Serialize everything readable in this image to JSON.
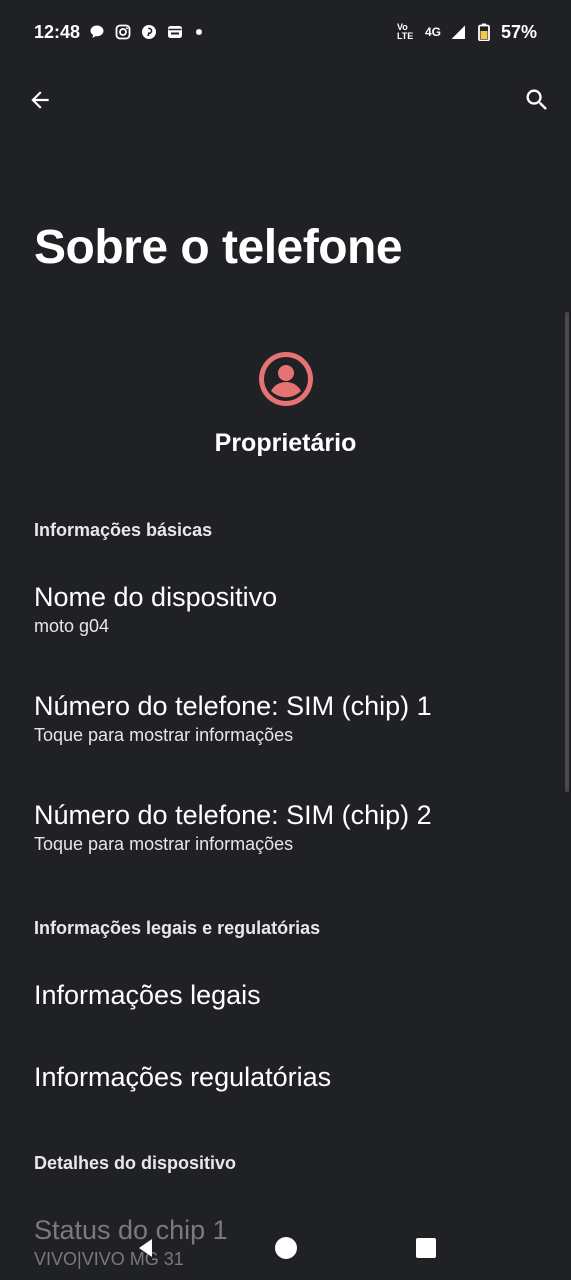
{
  "status_bar": {
    "time": "12:48",
    "net_volte": "Vo LTE",
    "net_type": "4G",
    "battery": "57%",
    "icons": [
      "chat-bubble-icon",
      "instagram-icon",
      "pinterest-icon",
      "mail-icon",
      "dot-icon",
      "signal-icon",
      "battery-icon"
    ]
  },
  "appbar": {
    "back_icon": "arrow-left-icon",
    "search_icon": "search-icon"
  },
  "page": {
    "title": "Sobre o telefone"
  },
  "owner": {
    "name": "Proprietário",
    "avatar_color": "#e57373"
  },
  "sections": {
    "basic": {
      "header": "Informações básicas",
      "items": [
        {
          "title": "Nome do dispositivo",
          "summary": "moto g04"
        },
        {
          "title": "Número do telefone: SIM (chip) 1",
          "summary": "Toque para mostrar informações"
        },
        {
          "title": "Número do telefone: SIM (chip) 2",
          "summary": "Toque para mostrar informações"
        }
      ]
    },
    "legal": {
      "header": "Informações legais e regulatórias",
      "items": [
        {
          "title": "Informações legais"
        },
        {
          "title": "Informações regulatórias"
        }
      ]
    },
    "device": {
      "header": "Detalhes do dispositivo",
      "items": [
        {
          "title": "Status do chip 1",
          "summary": "VIVO|VIVO MG 31"
        }
      ]
    }
  },
  "colors": {
    "background": "#202124",
    "text": "#ffffff",
    "accent": "#e57373"
  }
}
